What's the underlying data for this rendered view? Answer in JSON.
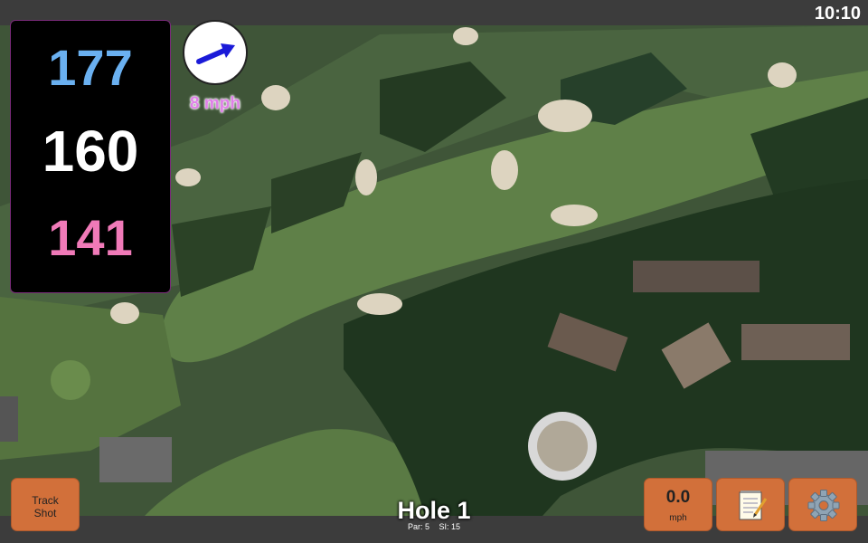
{
  "status": {
    "time": "10:10"
  },
  "distances": {
    "back": "177",
    "middle": "160",
    "front": "141"
  },
  "wind": {
    "speed": "8 mph",
    "icon": "wind-arrow-icon"
  },
  "buttons": {
    "track_shot_line1": "Track",
    "track_shot_line2": "Shot",
    "speed_value": "0.0",
    "speed_unit": "mph",
    "notes_icon": "notepad-icon",
    "settings_icon": "gear-icon"
  },
  "hole": {
    "title": "Hole 1",
    "par": "Par: 5",
    "si": "SI: 15"
  },
  "colors": {
    "back": "#6ab0f0",
    "middle": "#ffffff",
    "front": "#f07ab8",
    "button": "#d2703a",
    "wind_text": "#e080e8"
  }
}
